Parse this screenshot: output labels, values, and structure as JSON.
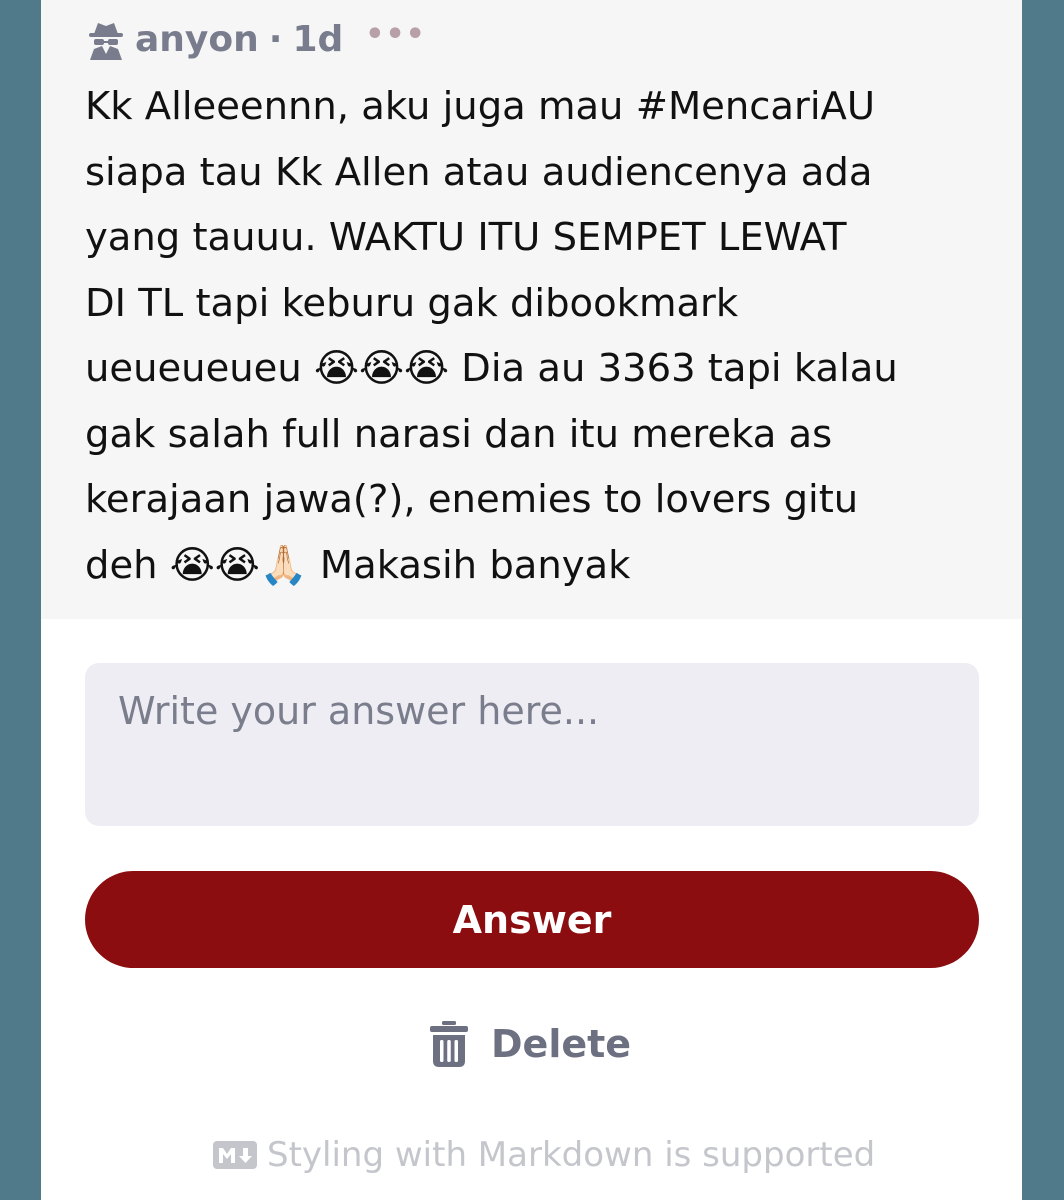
{
  "post": {
    "author": "anyon",
    "separator": "·",
    "age": "1d",
    "author_icon": "spy-icon",
    "more_icon": "more-options-icon",
    "more_glyph": "•••",
    "text": "Kk Alleeennn, aku juga mau #MencariAU\nsiapa tau Kk Allen atau audiencenya ada\nyang tauuu. WAKTU ITU SEMPET LEWAT\nDI TL tapi keburu gak dibookmark\nueueueueu 😭😭😭 Dia au 3363 tapi kalau\ngak salah full narasi dan itu mereka as\nkerajaan jawa(?), enemies to lovers gitu\ndeh 😭😭🙏🏻 Makasih banyak"
  },
  "answer_form": {
    "placeholder": "Write your answer here...",
    "value": "",
    "submit_label": "Answer",
    "delete_label": "Delete",
    "delete_icon": "trash-icon",
    "markdown_icon": "markdown-icon",
    "markdown_note": "Styling with Markdown is supported"
  },
  "colors": {
    "page_background": "#507a8a",
    "question_background": "#f6f6f6",
    "input_background": "#efedf4",
    "answer_button": "#8b0d0f",
    "muted_text": "#787c8d"
  }
}
